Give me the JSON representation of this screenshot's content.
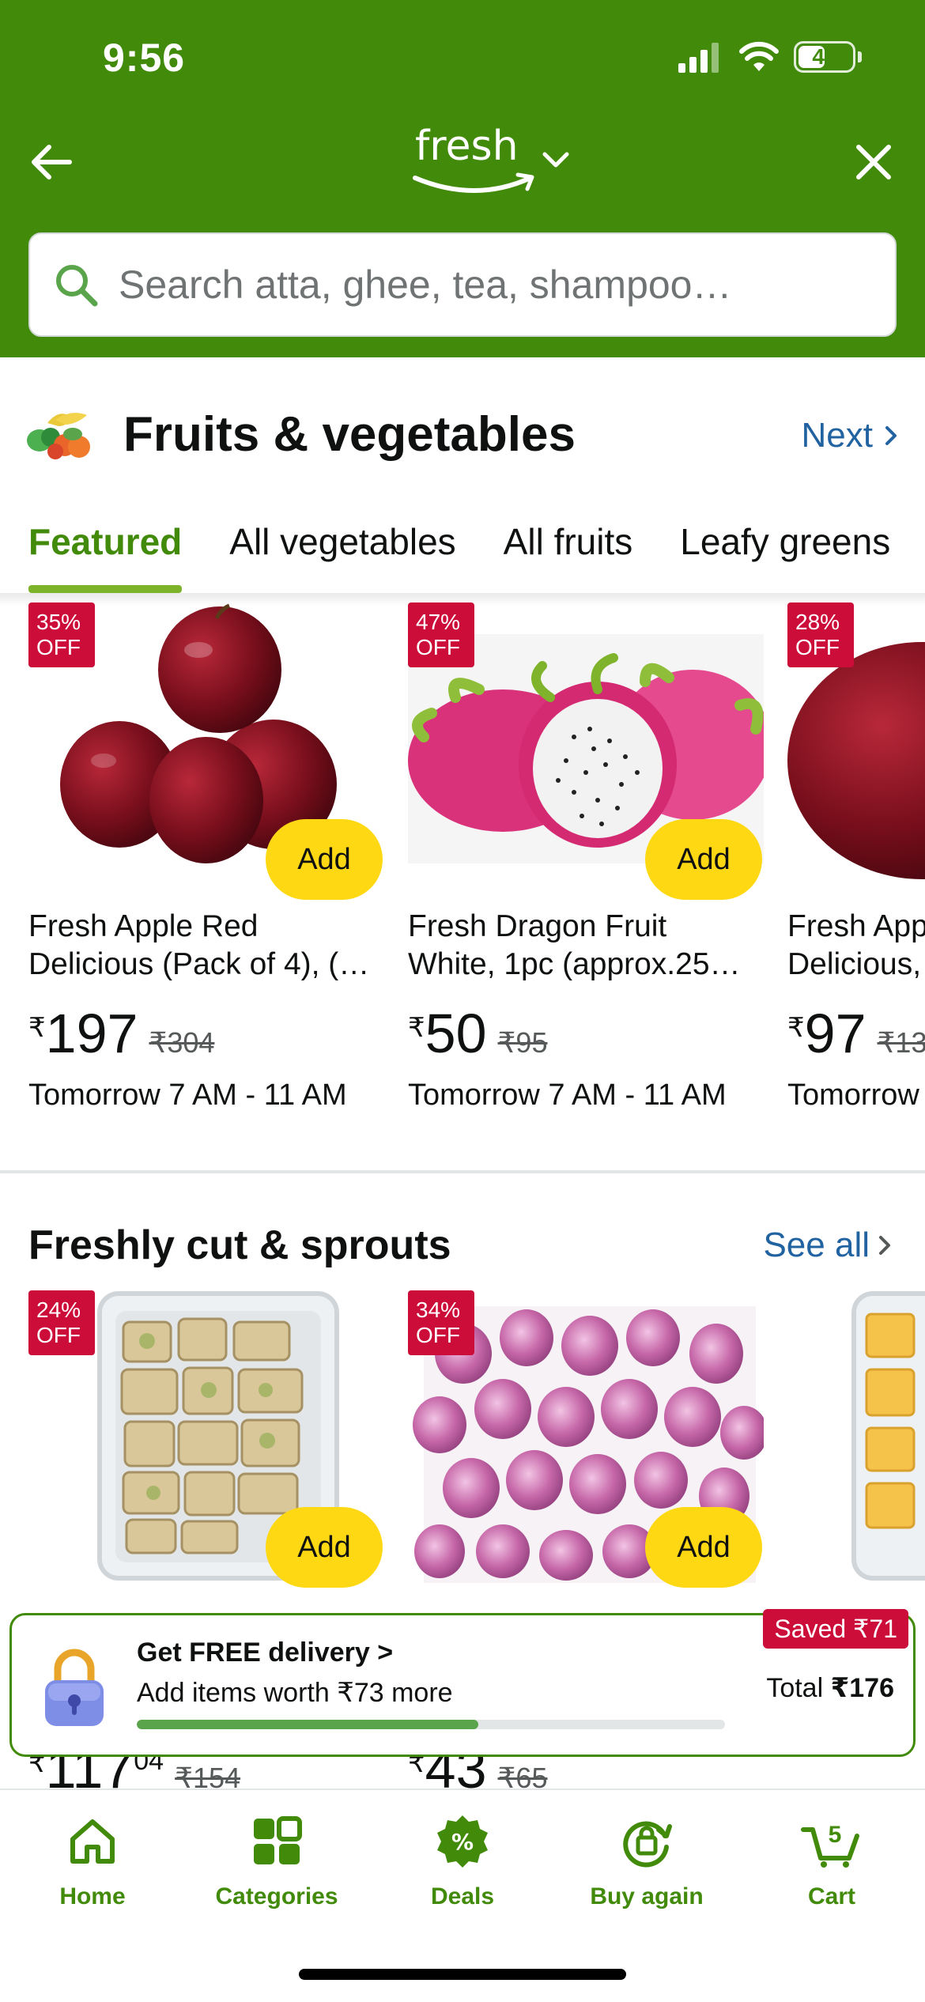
{
  "status_bar": {
    "time": "9:56",
    "battery": "45"
  },
  "header": {
    "logo_text": "fresh",
    "search_placeholder": "Search atta, ghee, tea, shampoo…"
  },
  "category": {
    "title": "Fruits & vegetables",
    "next_label": "Next"
  },
  "tabs": [
    {
      "label": "Featured",
      "active": true
    },
    {
      "label": "All vegetables",
      "active": false
    },
    {
      "label": "All fruits",
      "active": false
    },
    {
      "label": "Leafy greens",
      "active": false
    }
  ],
  "featured_products": [
    {
      "badge_pct": "35%",
      "badge_off": "OFF",
      "name_line1": "Fresh Apple Red",
      "name_line2": "Delicious (Pack of 4), (…",
      "currency": "₹",
      "price": "197",
      "mrp": "₹304",
      "delivery": "Tomorrow 7 AM - 11 AM",
      "add_label": "Add"
    },
    {
      "badge_pct": "47%",
      "badge_off": "OFF",
      "name_line1": "Fresh Dragon Fruit",
      "name_line2": "White, 1pc (approx.25…",
      "currency": "₹",
      "price": "50",
      "mrp": "₹95",
      "delivery": "Tomorrow 7 AM - 11 AM",
      "add_label": "Add"
    },
    {
      "badge_pct": "28%",
      "badge_off": "OFF",
      "name_line1": "Fresh Apple",
      "name_line2": "Delicious,",
      "currency": "₹",
      "price": "97",
      "mrp": "₹13",
      "delivery": "Tomorrow",
      "add_label": "Add"
    }
  ],
  "section": {
    "title": "Freshly cut & sprouts",
    "see_all": "See all"
  },
  "cut_products": [
    {
      "badge_pct": "24%",
      "badge_off": "OFF",
      "add_label": "Add",
      "currency": "₹",
      "price": "117",
      "price_frac": "04",
      "mrp": "₹154"
    },
    {
      "badge_pct": "34%",
      "badge_off": "OFF",
      "add_label": "Add",
      "currency": "₹",
      "price": "43",
      "mrp": "₹65"
    }
  ],
  "free_delivery": {
    "title": "Get FREE delivery >",
    "subtitle": "Add items worth ₹73 more",
    "saved": "Saved ₹71",
    "total_label": "Total",
    "total_value": "₹176",
    "progress": 0.58
  },
  "bottom_nav": {
    "home": "Home",
    "categories": "Categories",
    "deals": "Deals",
    "buy_again": "Buy again",
    "cart": "Cart",
    "cart_count": "5"
  },
  "colors": {
    "brand_green": "#418a0a",
    "badge_red": "#cc0c39",
    "add_yellow": "#ffd814",
    "link_blue": "#2162a1"
  }
}
